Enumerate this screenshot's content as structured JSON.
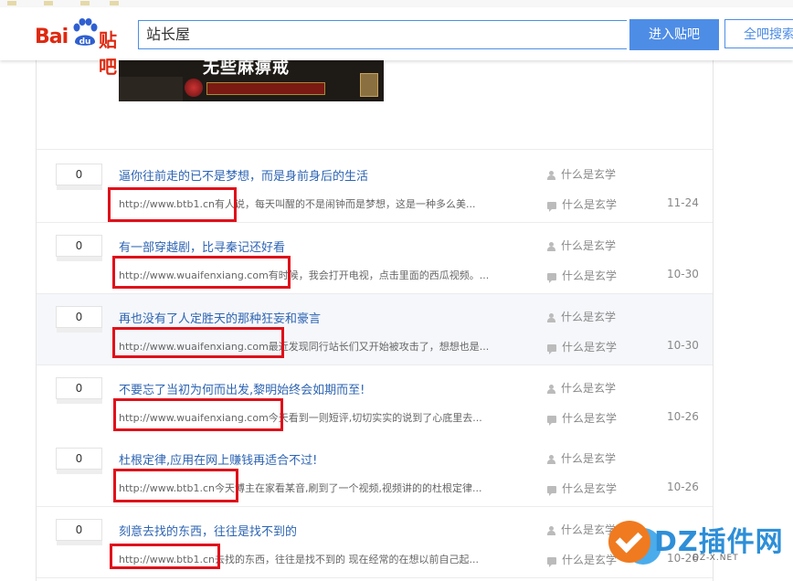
{
  "header": {
    "logo_text": "Bai",
    "logo_paw_text": "du",
    "logo_tieba": "贴吧",
    "search_value": "站长屋",
    "enter_button": "进入贴吧",
    "all_search_button": "全吧搜索"
  },
  "banner": {
    "caption": "无些麻痹戒"
  },
  "threads": [
    {
      "replies": "0",
      "title": "逼你往前走的已不是梦想，而是身前身后的生活",
      "abstract": "http://www.btb1.cn有人说，每天叫醒的不是闹钟而是梦想，这是一种多么美...",
      "author": "什么是玄学",
      "last_reply": "什么是玄学",
      "date": "11-24"
    },
    {
      "replies": "0",
      "title": "有一部穿越剧，比寻秦记还好看",
      "abstract": "http://www.wuaifenxiang.com有时候，我会打开电视，点击里面的西瓜视频。...",
      "author": "什么是玄学",
      "last_reply": "什么是玄学",
      "date": "10-30"
    },
    {
      "replies": "0",
      "title": "再也没有了人定胜天的那种狂妄和豪言",
      "abstract": "http://www.wuaifenxiang.com最近发现同行站长们又开始被攻击了，想想也是...",
      "author": "什么是玄学",
      "last_reply": "什么是玄学",
      "date": "10-30"
    },
    {
      "replies": "0",
      "title": "不要忘了当初为何而出发,黎明始终会如期而至!",
      "abstract": "http://www.wuaifenxiang.com今天看到一则短评,切切实实的说到了心底里去...",
      "author": "什么是玄学",
      "last_reply": "什么是玄学",
      "date": "10-26"
    },
    {
      "replies": "0",
      "title": "杜根定律,应用在网上赚钱再适合不过!",
      "abstract": "http://www.btb1.cn今天博主在家看某音,刷到了一个视频,视频讲的的杜根定律...",
      "author": "什么是玄学",
      "last_reply": "什么是玄学",
      "date": "10-26"
    },
    {
      "replies": "0",
      "title": "刻意去找的东西，往往是找不到的",
      "abstract": "http://www.btb1.cn去找的东西，往往是找不到的 现在经常的在想以前自己起...",
      "author": "什么是玄学",
      "last_reply": "什么是玄学",
      "date": "10-26"
    }
  ],
  "watermark": {
    "brand": "DZ插件网",
    "domain": "DZ-X.NET"
  },
  "colors": {
    "link_blue": "#2d64b3",
    "button_blue": "#4e8de6",
    "highlight_red": "#e0101a",
    "baidu_red": "#de2910"
  }
}
